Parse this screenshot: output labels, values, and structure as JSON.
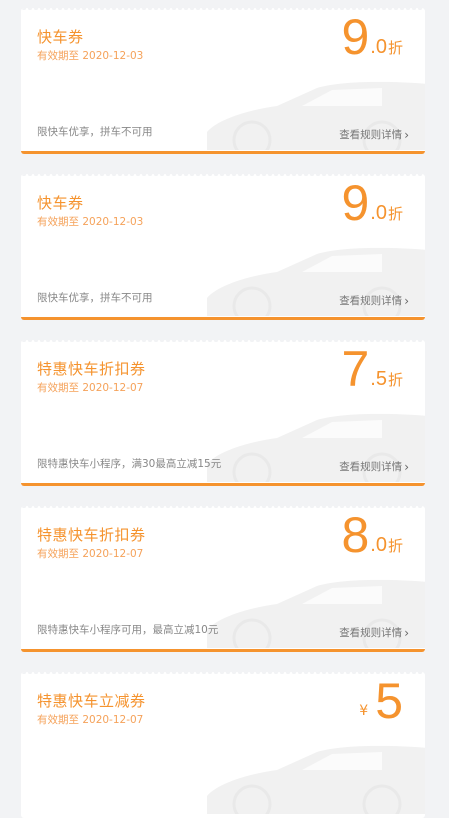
{
  "coupons": [
    {
      "title": "快车券",
      "validity": "有效期至 2020-12-03",
      "amount": "9",
      "decimal": ".0",
      "unit": "折",
      "restriction": "限快车优享，拼车不可用",
      "rules_link": "查看规则详情"
    },
    {
      "title": "快车券",
      "validity": "有效期至 2020-12-03",
      "amount": "9",
      "decimal": ".0",
      "unit": "折",
      "restriction": "限快车优享，拼车不可用",
      "rules_link": "查看规则详情"
    },
    {
      "title": "特惠快车折扣券",
      "validity": "有效期至 2020-12-07",
      "amount": "7",
      "decimal": ".5",
      "unit": "折",
      "restriction": "限特惠快车小程序，满30最高立减15元",
      "rules_link": "查看规则详情"
    },
    {
      "title": "特惠快车折扣券",
      "validity": "有效期至 2020-12-07",
      "amount": "8",
      "decimal": ".0",
      "unit": "折",
      "restriction": "限特惠快车小程序可用，最高立减10元",
      "rules_link": "查看规则详情"
    },
    {
      "title": "特惠快车立减券",
      "validity": "有效期至 2020-12-07",
      "currency": "¥",
      "amount": "5"
    }
  ],
  "icons": {
    "chevron": "chevron-right-icon",
    "watermark": "car-silhouette-icon"
  },
  "colors": {
    "accent": "#f5932e",
    "background": "#f2f3f5"
  }
}
